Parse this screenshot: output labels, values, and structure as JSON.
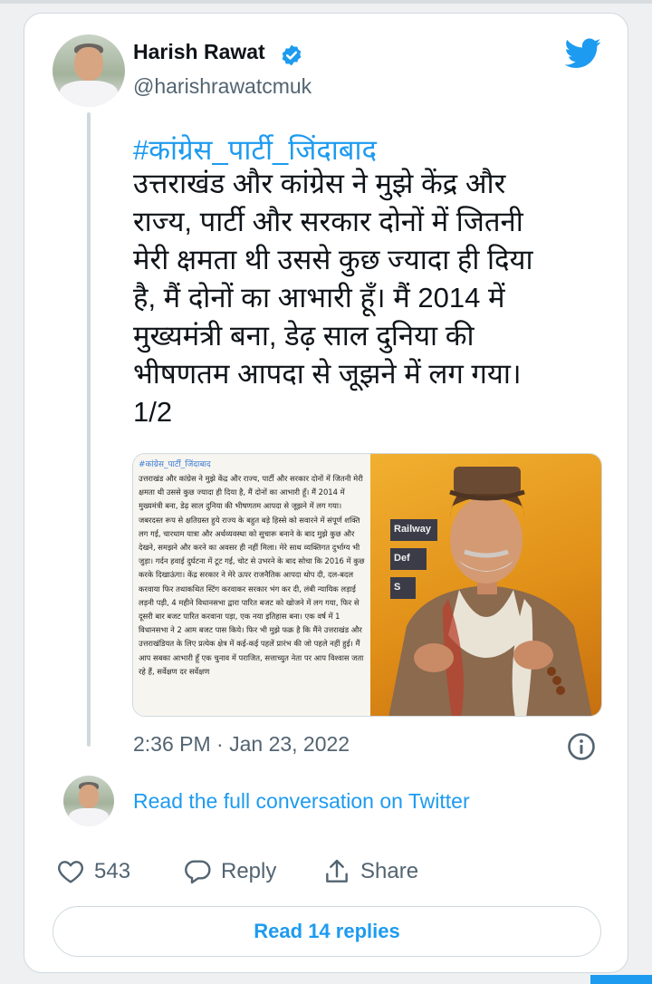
{
  "tweet": {
    "author_name": "Harish Rawat",
    "author_handle": "@harishrawatcmuk",
    "hashtag": "#कांग्रेस_पार्टी_जिंदाबाद",
    "text": "उत्तराखंड और कांग्रेस ने मुझे केंद्र और\nराज्य, पार्टी और सरकार दोनों में जितनी\nमेरी क्षमता थी उससे कुछ ज्यादा ही दिया\nहै, मैं दोनों का आभारी हूँ। मैं 2014 में\nमुख्यमंत्री बना, डेढ़ साल दुनिया की\nभीषणतम आपदा से जूझने में लग गया।\n1/2",
    "timestamp": "2:36 PM · Jan 23, 2022"
  },
  "media": {
    "doc_hashtag": "#कांग्रेस_पार्टी_जिंदाबाद",
    "doc_text": "उत्तराखंड और कांग्रेस ने मुझे केंद्र और राज्य, पार्टी और सरकार दोनों में जितनी मेरी क्षमता थी उससे कुछ ज्यादा ही दिया है, मैं दोनों का आभारी हूँ। मैं 2014 में मुख्यमंत्री बना, डेढ़ साल दुनिया की भीषणतम आपदा से जूझने में लग गया। जबरदस्त रूप से क्षतिग्रस्त हुये राज्य के बहुत बड़े हिस्से को सवारने में संपूर्ण शक्ति लग गई, चारधाम यात्रा और अर्थव्यवस्था को सुचारू बनाने के बाद मुझे कुछ और देखने, समझने और करने का अवसर ही नहीं मिला। मेरे साथ व्यक्तिगत दुर्भाग्य भी जुड़ा। गर्दन हवाई दुर्घटना में टूट गई, चोट से उभरने के बाद सोचा कि 2016 में कुछ करके दिखाऊंगा। केंद्र सरकार ने मेरे ऊपर राजनैतिक आपदा थोप दी, दल-बदल करवाया फिर तथाकथित स्टिंग करवाकर सरकार भंग कर दी, लंबी न्यायिक लड़ाई लड़नी पड़ी, 4 महीने विधानसभा द्वारा पारित बजट को खोजने में लग गया, फिर से दूसरी बार बजट पारित करवाना पड़ा, एक नया इतिहास बना। एक वर्ष में 1 विधानसभा ने 2 आम बजट पास किये। फिर भी मुझे फक्र है कि मैंने उत्तराखंड और उत्तराखंडियत के लिए प्रत्येक क्षेत्र में कई-कई पहलें प्रारंभ की जो पहले नहीं हुई। मैं आप सबका आभारी हूँ एक चुनाव में पराजित, सत्ताच्युत नेता पर आप विश्वास जता रहे हैं, सर्वेक्षण दर सर्वेक्षण",
    "board_labels": [
      "Railway",
      "Def",
      "S"
    ]
  },
  "links": {
    "read_full": "Read the full conversation on Twitter"
  },
  "actions": {
    "like_count": "543",
    "reply_label": "Reply",
    "share_label": "Share"
  },
  "replies_button": "Read 14 replies",
  "colors": {
    "accent": "#1d9bf0",
    "text": "#0f1419",
    "muted": "#536471",
    "border": "#cfd9de"
  },
  "icons": [
    "verified-badge-icon",
    "twitter-bird-icon",
    "info-icon",
    "heart-icon",
    "reply-bubble-icon",
    "share-icon"
  ]
}
